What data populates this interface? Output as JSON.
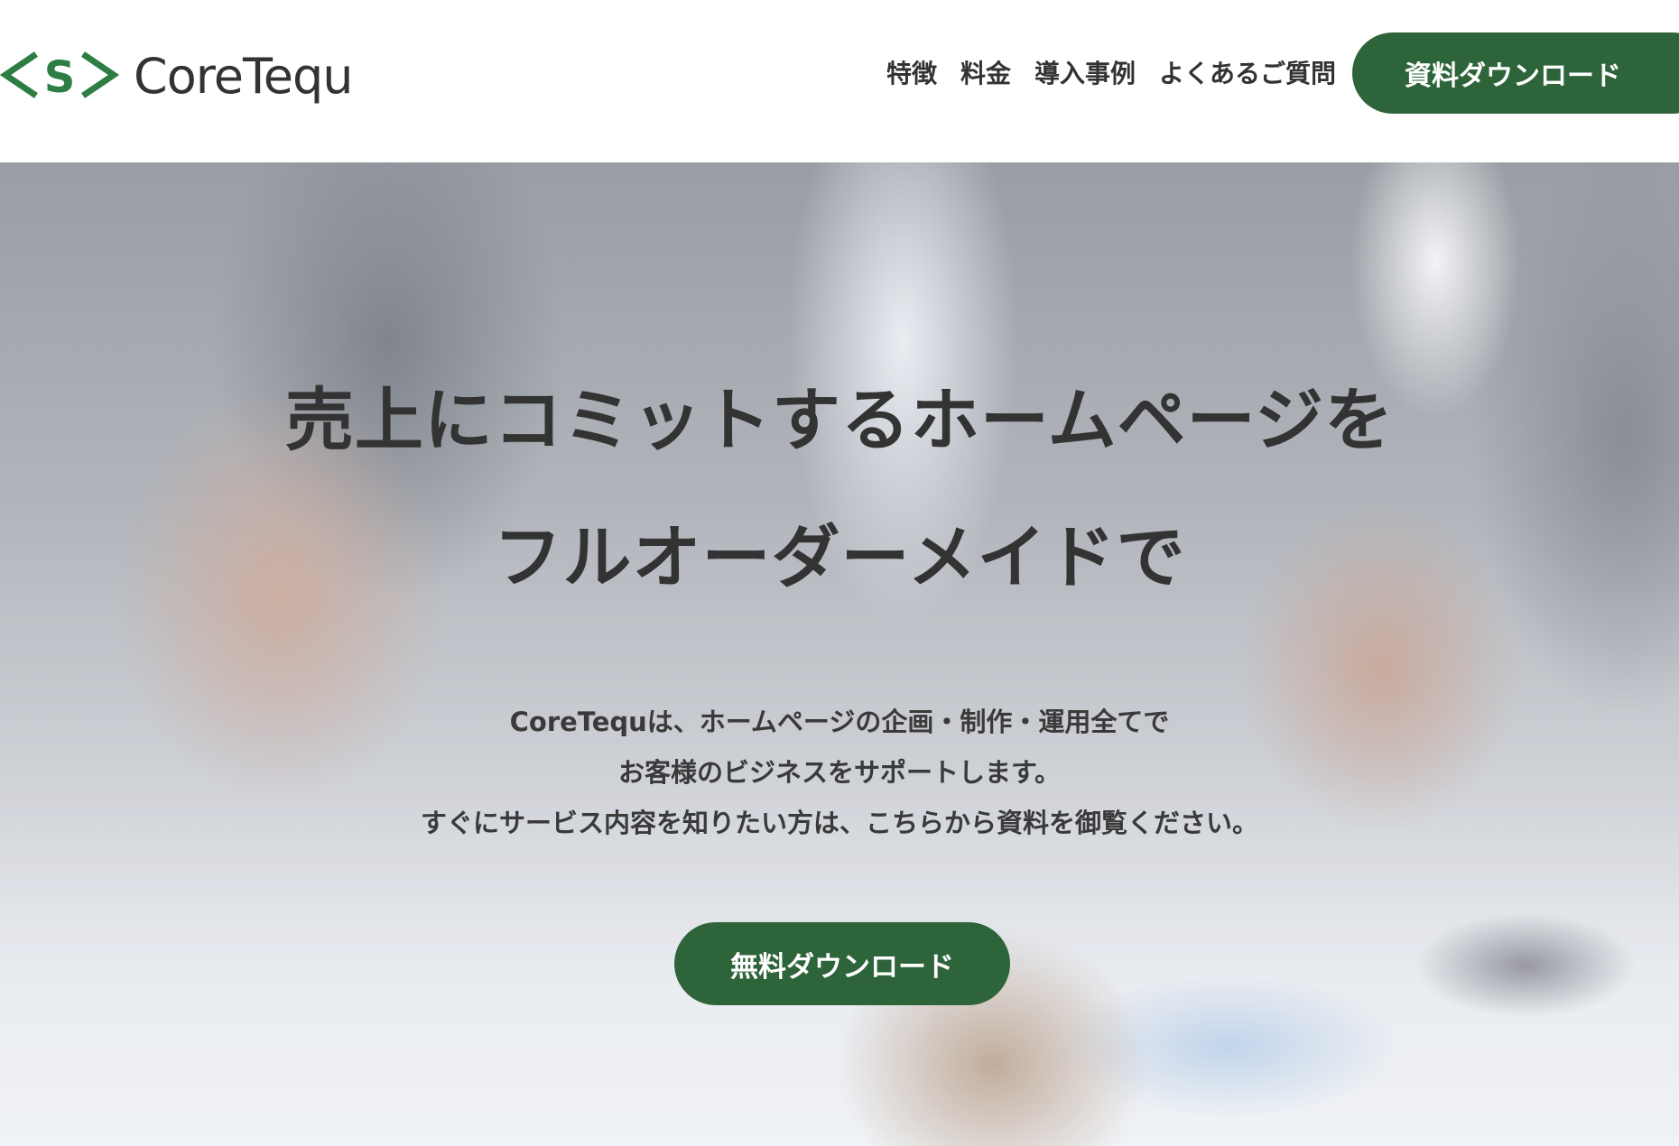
{
  "header": {
    "logo": {
      "mark_text": "<S>",
      "name": "CoreTequ",
      "mark_color": "#2e7d43"
    },
    "nav": [
      {
        "label": "特徴"
      },
      {
        "label": "料金"
      },
      {
        "label": "導入事例"
      },
      {
        "label": "よくあるご質問"
      }
    ],
    "cta_label": "資料ダウンロード"
  },
  "hero": {
    "headline_line1": "売上にコミットするホームページを",
    "headline_line2": "フルオーダーメイドで",
    "description": [
      "CoreTequは、ホームページの企画・制作・運用全てで",
      "お客様のビジネスをサポートします。",
      "すぐにサービス内容を知りたい方は、こちらから資料を御覧ください。"
    ],
    "cta_label": "無料ダウンロード"
  },
  "colors": {
    "brand_green": "#2e6439",
    "text_dark": "#333333",
    "button_text": "#ffffff"
  }
}
